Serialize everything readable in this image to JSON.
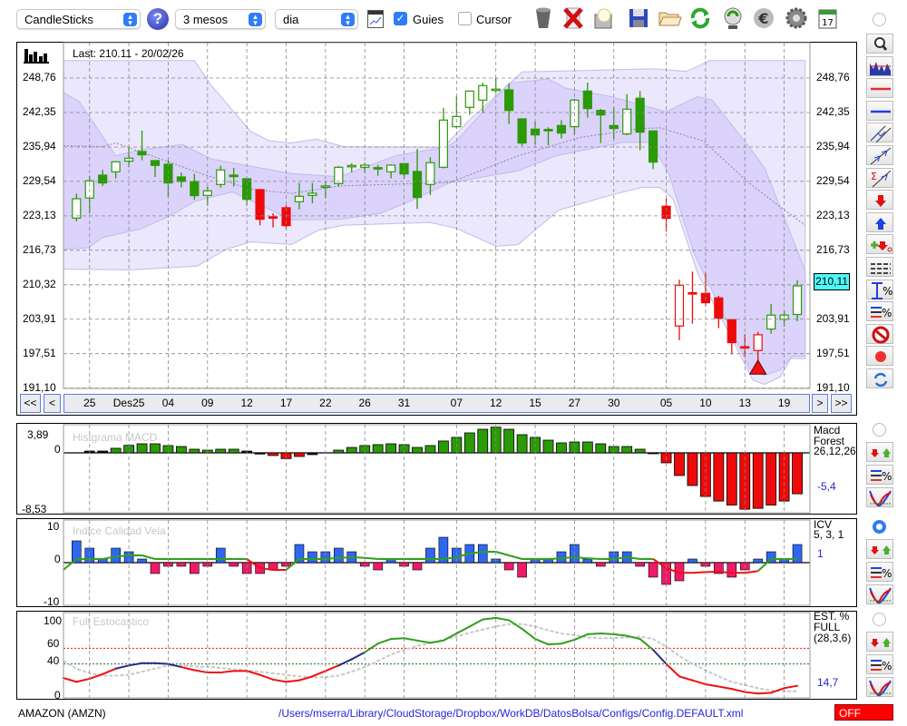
{
  "toolbar": {
    "chart_type": "CandleSticks",
    "period": "3 mesos",
    "interval": "dia",
    "guides_label": "Guies",
    "guides_checked": true,
    "cursor_label": "Cursor",
    "cursor_checked": false,
    "icons": [
      "help-icon",
      "chart-window-icon",
      "trash-icon",
      "delete-icon",
      "preview-icon",
      "save-icon",
      "folder-icon",
      "refresh-icon",
      "recycle-icon",
      "euro-icon",
      "gear-icon",
      "calendar-icon"
    ],
    "calendar_day": "17"
  },
  "main_chart": {
    "last_label": "Last: 210.11 - 20/02/26",
    "current_price": "210,11",
    "y_ticks": [
      "248,76",
      "242,35",
      "235,94",
      "229,54",
      "223,13",
      "216,73",
      "210,32",
      "203,91",
      "197,51",
      "191,10"
    ],
    "y_tick_values": [
      248.76,
      242.35,
      235.94,
      229.54,
      223.13,
      216.73,
      210.32,
      203.91,
      197.51,
      191.1
    ],
    "y_range": [
      191.1,
      248.76
    ],
    "x_labels": [
      "25",
      "Des25",
      "04",
      "09",
      "12",
      "17",
      "22",
      "26",
      "31",
      "07",
      "12",
      "15",
      "27",
      "30",
      "05",
      "10",
      "13",
      "19"
    ],
    "x_label_index": [
      1,
      4,
      7,
      10,
      13,
      16,
      19,
      22,
      25,
      29,
      32,
      35,
      38,
      41,
      45,
      48,
      51,
      54
    ],
    "nav": {
      "first": "<<",
      "prev": "<",
      "next": ">",
      "last": ">>"
    },
    "colors": {
      "up": "#2a9a06",
      "down_alert": "#ee0a0a",
      "band": "#d9d2fa"
    },
    "candles": [
      [
        222.73,
        227.28,
        222.11,
        226.32,
        "g"
      ],
      [
        226.44,
        230.6,
        223.63,
        229.64,
        "g"
      ],
      [
        230.71,
        231.67,
        228.69,
        229.25,
        "g"
      ],
      [
        231.33,
        233.3,
        230.09,
        233.18,
        "g"
      ],
      [
        233.3,
        235.88,
        232.17,
        233.86,
        "g"
      ],
      [
        235.1,
        238.98,
        233.47,
        234.48,
        "g"
      ],
      [
        233.41,
        233.41,
        230.37,
        232.51,
        "g"
      ],
      [
        232.73,
        233.52,
        226.66,
        229.25,
        "g"
      ],
      [
        230.37,
        231.22,
        228.4,
        229.53,
        "g"
      ],
      [
        229.53,
        230.93,
        226.15,
        226.89,
        "g"
      ],
      [
        226.94,
        228.58,
        225.03,
        227.79,
        "g"
      ],
      [
        228.97,
        232.45,
        228.4,
        231.67,
        "g"
      ],
      [
        230.71,
        232.06,
        228.58,
        230.43,
        "g"
      ],
      [
        230.04,
        230.04,
        225.03,
        226.21,
        "g"
      ],
      [
        228.01,
        228.01,
        221.38,
        222.5,
        "r"
      ],
      [
        222.96,
        223.63,
        220.98,
        222.73,
        "r"
      ],
      [
        224.64,
        225.03,
        220.81,
        221.32,
        "r"
      ],
      [
        225.76,
        229.25,
        224.36,
        226.77,
        "g"
      ],
      [
        226.94,
        229.25,
        225.48,
        227.34,
        "g"
      ],
      [
        228.58,
        229.64,
        226.44,
        228.7,
        "g"
      ],
      [
        229.14,
        232.4,
        228.58,
        232.17,
        "g"
      ],
      [
        232.4,
        232.9,
        231.22,
        232.5,
        "g"
      ],
      [
        232.17,
        233.02,
        231.1,
        232.57,
        "g"
      ],
      [
        232.1,
        232.62,
        230.6,
        232.06,
        "g"
      ],
      [
        231.33,
        232.73,
        230.09,
        232.57,
        "g"
      ],
      [
        232.85,
        232.85,
        230.09,
        230.93,
        "g"
      ],
      [
        231.38,
        235.55,
        224.41,
        226.55,
        "g"
      ],
      [
        228.97,
        234.03,
        227.0,
        233.02,
        "g"
      ],
      [
        232.17,
        243.19,
        231.95,
        240.94,
        "g"
      ],
      [
        239.71,
        245.39,
        239.37,
        241.62,
        "g"
      ],
      [
        243.31,
        246.34,
        241.9,
        246.34,
        "g"
      ],
      [
        244.66,
        247.92,
        242.29,
        247.35,
        "g"
      ],
      [
        246.6,
        248.82,
        246.0,
        246.7,
        "g"
      ],
      [
        246.57,
        247.69,
        240.21,
        242.74,
        "g"
      ],
      [
        241.17,
        241.17,
        236.16,
        236.67,
        "g"
      ],
      [
        239.26,
        240.72,
        236.44,
        238.19,
        "g"
      ],
      [
        239.2,
        239.6,
        236.27,
        239.1,
        "g"
      ],
      [
        239.93,
        240.94,
        237.51,
        238.53,
        "g"
      ],
      [
        239.71,
        244.88,
        238.13,
        244.66,
        "g"
      ],
      [
        246.34,
        247.92,
        241.39,
        243.08,
        "g"
      ],
      [
        242.74,
        243.02,
        236.67,
        241.9,
        "g"
      ],
      [
        239.93,
        243.31,
        237.4,
        239.37,
        "g"
      ],
      [
        238.36,
        245.78,
        238.13,
        242.97,
        "g"
      ],
      [
        245.0,
        246.34,
        235.32,
        238.7,
        "g"
      ],
      [
        238.92,
        238.92,
        231.83,
        233.13,
        "g"
      ],
      [
        224.92,
        226.32,
        220.25,
        222.67,
        "r"
      ],
      [
        202.65,
        211.26,
        200.01,
        210.24,
        "r"
      ],
      [
        208.85,
        212.77,
        203.1,
        208.8,
        "r"
      ],
      [
        208.72,
        212.6,
        206.31,
        206.98,
        "r"
      ],
      [
        207.88,
        208.27,
        202.26,
        204.11,
        "r"
      ],
      [
        203.83,
        203.83,
        197.37,
        199.56,
        "r"
      ],
      [
        198.8,
        201.13,
        197.03,
        198.75,
        "r"
      ],
      [
        198.1,
        201.58,
        195.79,
        201.02,
        "r"
      ],
      [
        202.09,
        206.76,
        201.24,
        204.68,
        "g"
      ],
      [
        203.89,
        205.52,
        202.54,
        204.68,
        "g"
      ],
      [
        204.79,
        211.14,
        203.55,
        210.11,
        "g"
      ]
    ],
    "signal_marker_index": 52,
    "bands": {
      "outer_upper": [
        [
          -1,
          252
        ],
        [
          9,
          252
        ],
        [
          10.3,
          247.35
        ],
        [
          13.3,
          238.81
        ],
        [
          14.7,
          237.12
        ],
        [
          16.3,
          236.67
        ],
        [
          18.3,
          237.4
        ],
        [
          20.4,
          236.0
        ],
        [
          28,
          235.9
        ],
        [
          30,
          241
        ],
        [
          34,
          249.9
        ],
        [
          39.5,
          250.2
        ],
        [
          44,
          250.5
        ],
        [
          46.5,
          250
        ],
        [
          47.3,
          250.8
        ],
        [
          48.3,
          252
        ],
        [
          55.6,
          252
        ]
      ],
      "outer_lower": [
        [
          -1,
          213.22
        ],
        [
          4.2,
          213.1
        ],
        [
          9.2,
          213.78
        ],
        [
          11.4,
          216.9
        ],
        [
          13.3,
          218.3
        ],
        [
          16.4,
          217.8
        ],
        [
          18.5,
          220.5
        ],
        [
          20.4,
          221.4
        ],
        [
          27,
          221.9
        ],
        [
          29,
          220.8
        ],
        [
          32,
          217.5
        ],
        [
          33.7,
          217.8
        ],
        [
          36.8,
          224.2
        ],
        [
          40.8,
          227.0
        ],
        [
          43.1,
          228.4
        ],
        [
          44.5,
          228.4
        ],
        [
          45.5,
          226.4
        ],
        [
          47.4,
          212.4
        ],
        [
          50.2,
          199.45
        ],
        [
          51.6,
          192.6
        ],
        [
          52.5,
          191.8
        ],
        [
          53.7,
          193.2
        ],
        [
          54.5,
          196.6
        ],
        [
          55.6,
          196.6
        ]
      ],
      "inner_upper": [
        [
          -1,
          246.1
        ],
        [
          0.2,
          244.4
        ],
        [
          3,
          234.3
        ],
        [
          5,
          235.5
        ],
        [
          8.1,
          236.4
        ],
        [
          10.3,
          233.7
        ],
        [
          16.4,
          231.0
        ],
        [
          20.1,
          230.4
        ],
        [
          24.3,
          234.3
        ],
        [
          28.3,
          236.0
        ],
        [
          29,
          237.1
        ],
        [
          33,
          247.8
        ],
        [
          36,
          248.6
        ],
        [
          37.3,
          246.9
        ],
        [
          40.8,
          245.3
        ],
        [
          45,
          242.5
        ],
        [
          47.4,
          245.3
        ],
        [
          48.5,
          244.7
        ],
        [
          51.3,
          236.0
        ],
        [
          52.5,
          232.1
        ],
        [
          55.6,
          213.0
        ]
      ],
      "inner_lower": [
        [
          -1,
          216.9
        ],
        [
          0.9,
          217.2
        ],
        [
          2,
          219.1
        ],
        [
          4.9,
          220.7
        ],
        [
          7.1,
          223.1
        ],
        [
          9.1,
          225.9
        ],
        [
          11.9,
          227.6
        ],
        [
          16.4,
          222.4
        ],
        [
          20.1,
          222.5
        ],
        [
          23.2,
          223.6
        ],
        [
          25.5,
          225.9
        ],
        [
          28.5,
          229.3
        ],
        [
          33.7,
          231.5
        ],
        [
          36.6,
          234.3
        ],
        [
          41.7,
          236.8
        ],
        [
          43.8,
          236.8
        ],
        [
          45.2,
          231.0
        ],
        [
          47.1,
          216.3
        ],
        [
          50.2,
          200.6
        ],
        [
          51.4,
          194.5
        ],
        [
          52.5,
          193.5
        ],
        [
          53.7,
          194.5
        ],
        [
          54.6,
          197
        ],
        [
          55.6,
          197
        ]
      ],
      "mid": [
        [
          -1,
          236.2
        ],
        [
          2,
          236.0
        ],
        [
          3,
          236.7
        ],
        [
          9.5,
          231.0
        ],
        [
          13.3,
          228.1
        ],
        [
          16.4,
          227.3
        ],
        [
          20.1,
          228.7
        ],
        [
          28.3,
          229.3
        ],
        [
          29,
          229.8
        ],
        [
          33.7,
          234.3
        ],
        [
          38.4,
          237.7
        ],
        [
          43.1,
          239.4
        ],
        [
          44.5,
          239.5
        ],
        [
          47.8,
          237.1
        ],
        [
          51.3,
          229.3
        ],
        [
          53.7,
          224.8
        ],
        [
          55.6,
          221.4
        ]
      ]
    }
  },
  "macd": {
    "title": "Histgrama MACD",
    "y_ticks": [
      "3,89",
      "0",
      "-8,53"
    ],
    "legend": [
      "Macd",
      "Forest",
      "26,12,26"
    ],
    "value": "-5,4",
    "values": [
      0,
      0.27,
      0.27,
      0.69,
      1.14,
      1.37,
      1.37,
      1.1,
      0.96,
      0.55,
      0.41,
      0.55,
      0.55,
      0.27,
      -0.18,
      -0.41,
      -0.87,
      -0.55,
      -0.27,
      0.02,
      0.41,
      0.82,
      1.1,
      1.24,
      1.37,
      1.24,
      0.82,
      1.1,
      1.79,
      2.34,
      3.02,
      3.57,
      3.89,
      3.57,
      2.75,
      2.34,
      1.92,
      1.51,
      1.65,
      1.65,
      1.37,
      0.96,
      0.96,
      0.55,
      -0.14,
      -1.51,
      -3.43,
      -4.95,
      -6.6,
      -7.3,
      -7.9,
      -8.53,
      -8.4,
      -7.9,
      -7.3,
      -6.2
    ]
  },
  "icv": {
    "title": "Indice Calidad Vela",
    "y_ticks": [
      "10",
      "0",
      "-10"
    ],
    "legend": [
      "ICV",
      "5, 3, 1"
    ],
    "value": "1",
    "bars": [
      6,
      4,
      1,
      4,
      3,
      1,
      -3,
      -1,
      -1,
      -3,
      -1,
      4,
      -1,
      -3,
      -3,
      -2,
      -1,
      5,
      3,
      3,
      4,
      3,
      -1,
      -2,
      1,
      -1,
      -2,
      4,
      7,
      4,
      5,
      5,
      1,
      -2,
      -4,
      1,
      1,
      3,
      5,
      1,
      -1,
      3,
      3,
      -1,
      -4,
      -6,
      -5,
      1,
      -1,
      -3,
      -4,
      -2,
      1,
      3,
      1,
      5
    ],
    "line_start": -2,
    "line": [
      1,
      1,
      1,
      1.7,
      2,
      2,
      1,
      1,
      1,
      1,
      1,
      1,
      1,
      1,
      -1.5,
      -2,
      -2,
      1,
      1,
      1,
      1.3,
      1.5,
      1.3,
      1,
      1,
      1,
      1,
      1,
      1,
      1.5,
      2.5,
      3,
      3,
      2,
      1,
      1,
      1,
      1.2,
      1.5,
      1.2,
      1,
      1,
      1.5,
      1,
      1,
      -1.5,
      -2.8,
      -2.8,
      -2.6,
      -2.5,
      -2.8,
      -2.8,
      -2.3,
      1,
      1,
      1
    ]
  },
  "stoch": {
    "title": "Full Estocastico",
    "y_ticks": [
      "100",
      "60",
      "40",
      "0"
    ],
    "legend": [
      "EST. %",
      "FULL",
      "(28,3,6)"
    ],
    "value": "14,7",
    "levels": [
      60,
      40
    ],
    "k_start": 22,
    "k": [
      17,
      21,
      27,
      34,
      38,
      41,
      41,
      40,
      36,
      32,
      29,
      29,
      31,
      31,
      26,
      20,
      17,
      19,
      24,
      31,
      38,
      46,
      55,
      66,
      72,
      73,
      70,
      67,
      70,
      79,
      88,
      97,
      99,
      96,
      85,
      72,
      65,
      66,
      71,
      78,
      79,
      78,
      76,
      72,
      58,
      40,
      24,
      19,
      14,
      11,
      8,
      4,
      2,
      3,
      9,
      12
    ],
    "d_start": 44,
    "d": [
      34,
      28,
      25,
      25,
      26,
      30,
      34,
      38,
      38,
      37,
      36,
      35,
      33,
      32,
      30,
      28,
      26,
      24,
      23,
      23,
      25,
      30,
      36,
      44,
      52,
      58,
      63,
      67,
      71,
      75,
      80,
      84,
      88,
      91,
      91,
      88,
      83,
      79,
      77,
      74,
      73,
      73,
      74,
      75,
      72,
      62,
      50,
      40,
      32,
      24,
      17,
      13,
      9,
      6,
      5,
      5
    ]
  },
  "status": {
    "symbol": "AMAZON (AMZN)",
    "config_path": "/Users/mserra/Library/CloudStorage/Dropbox/WorkDB/DatosBolsa/Configs/Config.DEFAULT.xml",
    "live_state": "OFF"
  },
  "sidebar": {
    "tools": [
      "zoom-icon",
      "volume-profile-icon",
      "red-horizontal-line-icon",
      "blue-horizontal-line-icon",
      "channel-icon",
      "trendline-icon",
      "sum-trendline-icon",
      "sell-arrow-icon",
      "buy-arrow-icon",
      "add-order-icon",
      "dashed-lines-icon",
      "percent-range-icon",
      "percent-levels-icon",
      "forbidden-icon",
      "record-icon",
      "sync-icon"
    ],
    "panel_tools": [
      "buy-sell-signals-icon",
      "percent-levels-icon",
      "indicator-curve-icon"
    ],
    "selected_panel": "icv"
  }
}
